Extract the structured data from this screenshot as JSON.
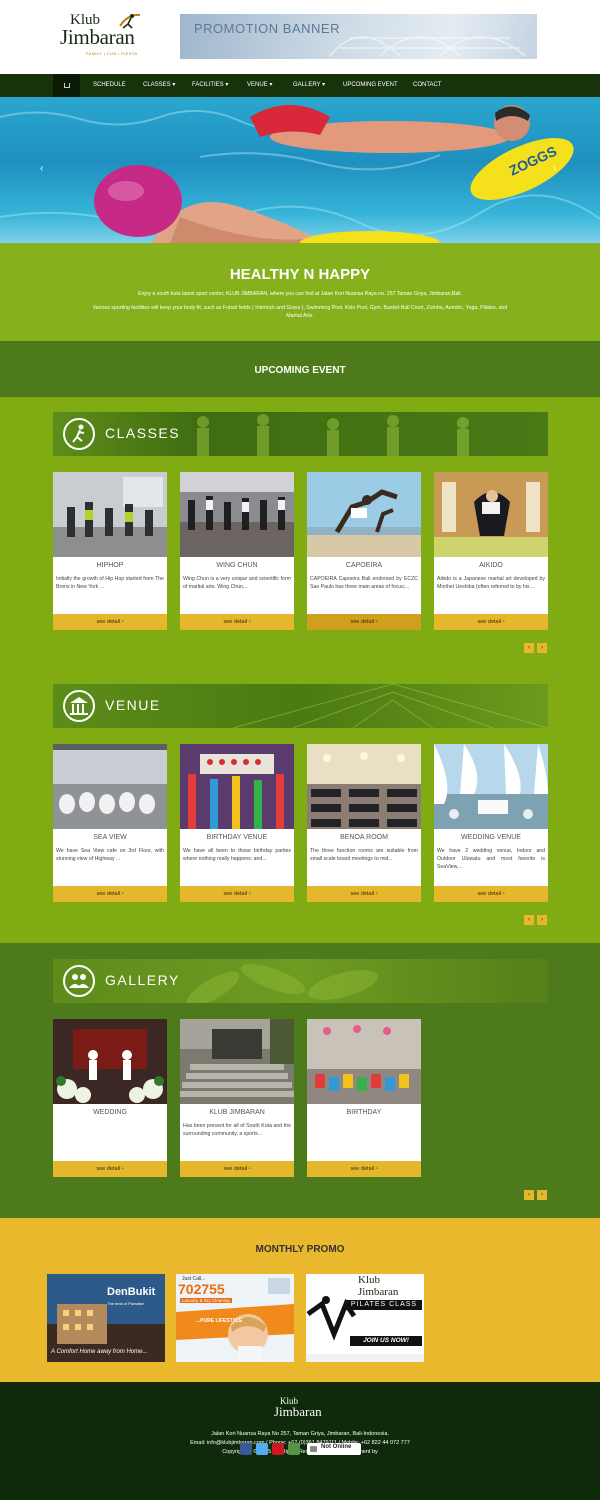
{
  "header": {
    "logo_top": "Klub",
    "logo_main": "Jimbaran",
    "logo_tagline": "FAMILY • FUN • FIESTA",
    "promo_banner": "PROMOTION BANNER"
  },
  "nav": {
    "items": [
      "SCHEDULE",
      "CLASSES ▾",
      "FACILITIES ▾",
      "VENUE ▾",
      "GALLERY ▾",
      "UPCOMING EVENT",
      "CONTACT"
    ]
  },
  "intro": {
    "title": "HEALTHY N HAPPY",
    "line1": "Enjoy a south kuta latest sport center, KLUB JIMBARAN, where you can find at Jalan Kori Nuansa Raya no. 257 Taman Griya, Jimbaran,Bali.",
    "line2": "Various sporting facilities will keep your body fit, such as Futsal fields ( Interlock and Grass ), Swimming Pool, Kids Pool, Gym, Basket Ball Court, Zumba, Aerobic, Yoga, Pilates, and",
    "line3": "Martial Arts."
  },
  "upcoming": {
    "title": "UPCOMING EVENT"
  },
  "classes": {
    "title": "CLASSES",
    "cards": [
      {
        "title": "HIPHOP",
        "desc": "Initially the growth of Hip Hop started from The Bronx in New York ...",
        "btn": "see detail"
      },
      {
        "title": "WING CHUN",
        "desc": "Wing Chun is a very unique and scientific form of martial arts. Wing Chun...",
        "btn": "see detail"
      },
      {
        "title": "CAPOEIRA",
        "desc": "CAPOEIRA Capoeira Bali endorsed by ECZC Sao Paulo has three main areas of focus;...",
        "btn": "see detail"
      },
      {
        "title": "AIKIDO",
        "desc": "Aikido is a Japanese martial art developed by Morihei Ueshiba (often referred to by his ...",
        "btn": "see detail"
      }
    ]
  },
  "venue": {
    "title": "VENUE",
    "cards": [
      {
        "title": "SEA VIEW",
        "desc": "We have Sea View cafe on 3rd Floor, with stunning view of Highway ...",
        "btn": "see detail"
      },
      {
        "title": "BIRTHDAY VENUE",
        "desc": "We have all been to those birthday parties where nothing really happens; and...",
        "btn": "see detail"
      },
      {
        "title": "BENOA ROOM",
        "desc": "The three function rooms are suitable from small scale board meetings to mid...",
        "btn": "see detail"
      },
      {
        "title": "WEDDING VENUE",
        "desc": "We have 2 wedding venue, Indoor and Outdoor Uluwatu and most favorite is SeaView,...",
        "btn": "see detail"
      }
    ]
  },
  "gallery": {
    "title": "GALLERY",
    "cards": [
      {
        "title": "WEDDING",
        "desc": "",
        "btn": "see detail"
      },
      {
        "title": "KLUB JIMBARAN",
        "desc": "Has been present for all of South Kuta and the surrounding community, a sports...",
        "btn": "see detail"
      },
      {
        "title": "BIRTHDAY",
        "desc": "",
        "btn": "see detail"
      }
    ]
  },
  "pager": {
    "prev": "‹",
    "next": "›"
  },
  "monthly": {
    "title": "MONTHLY PROMO",
    "promo1": {
      "brand": "DenBukit",
      "sub": "The best of Paradise",
      "slogan": "A Comfort Home away from Home..."
    },
    "promo2": {
      "top": "Just Call...",
      "number": "702755",
      "sub": "Laundry & Dry Cleaning",
      "tag": "...PURE LIFESTYLE"
    },
    "promo3": {
      "brand": "Klub Jimbaran",
      "cls": "PILATES CLASS",
      "cta": "JOIN US NOW!"
    }
  },
  "footer": {
    "logo_top": "Klub",
    "logo_main": "Jimbaran",
    "address": "Jalan Kori Nuansa Raya No 257, Taman Griya, Jimbaran, Bali-Indonesia.",
    "contact": "Email: info@klubjimbaran.com / Phone: +62 (0)361 8479111 / Mobile: +62 822 44 072 777",
    "copyright": "Copyrighted © 2015. All Rights Reserved. Web Development by",
    "not_online": "Not Online"
  },
  "colors": {
    "green": "#86b01c",
    "dark_green": "#4d7a1a",
    "nav": "#17330c",
    "gold": "#e5b72c",
    "footer": "#0e2a0a"
  }
}
